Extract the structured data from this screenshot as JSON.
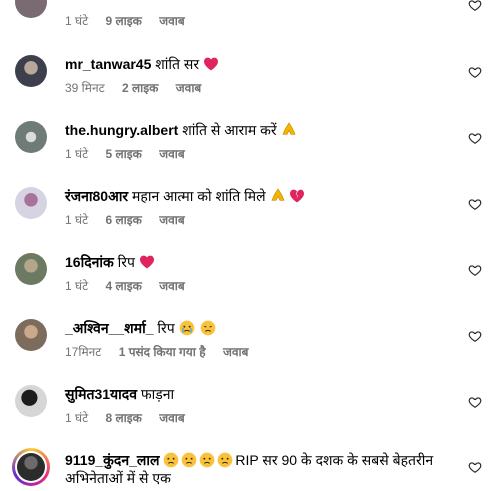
{
  "comments": [
    {
      "user": "",
      "text": "",
      "time": "1 घंटे",
      "likes": "9 लाइक",
      "reply": "जवाब",
      "avatar_color": "#7a6a72"
    },
    {
      "user": "mr_tanwar45",
      "text": "शांति सर",
      "emoji": "red-heart",
      "time": "39 मिनट",
      "likes": "2 लाइक",
      "reply": "जवाब",
      "avatar_color": "#5b5e6b"
    },
    {
      "user": "the.hungry.albert",
      "text": "शांति से आराम करें",
      "emoji": "folded-hands",
      "time": "1 घंटे",
      "likes": "5 लाइक",
      "reply": "जवाब",
      "avatar_color": "#6f7b77"
    },
    {
      "user": "रंजना80आर",
      "text": "महान आत्मा को शांति मिले",
      "emoji": "folded-hands broken-heart",
      "time": "1 घंटे",
      "likes": "6 लाइक",
      "reply": "जवाब",
      "avatar_color": "#c7c3d6"
    },
    {
      "user": "16दिनांक",
      "text": "रिप",
      "emoji": "red-heart",
      "time": "1 घंटे",
      "likes": "4 लाइक",
      "reply": "जवाब",
      "avatar_color": "#8c9a84"
    },
    {
      "user": "_अश्विन__शर्मा_",
      "text": "रिप",
      "emoji": "crying-face disappointed-face",
      "time": "17मिनट",
      "likes": "1 पसंद किया गया है",
      "reply": "जवाब",
      "avatar_color": "#9c8a78"
    },
    {
      "user": "सुमित31यादव",
      "text": "फाड़ना",
      "time": "1 घंटे",
      "likes": "8 लाइक",
      "reply": "जवाब",
      "avatar_color": "#4d4d4d"
    },
    {
      "user": "9119_कुंदन_लाल",
      "text": "RIP सर 90 के दशक के सबसे बेहतरीन अभिनेताओं में से एक",
      "emoji": "sad-face x4",
      "avatar_color": "#3a3a3a"
    }
  ],
  "colors": {
    "meta": "#737373",
    "heart_red": "#e0245e",
    "ring_gradient": [
      "#f9ce34",
      "#ee2a7b",
      "#6228d7"
    ]
  }
}
